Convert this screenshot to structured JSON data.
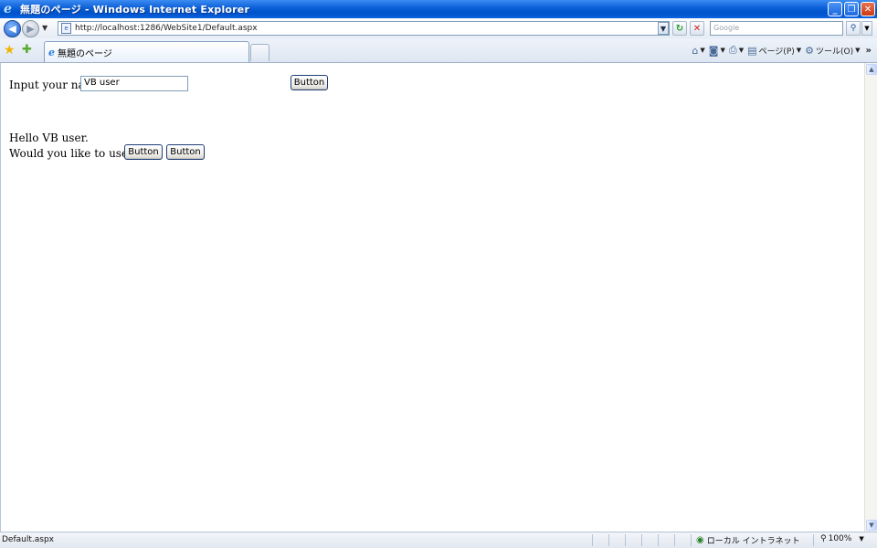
{
  "window": {
    "title": "無題のページ - Windows Internet Explorer",
    "minimize": "_",
    "maximize": "❐",
    "close": "✕"
  },
  "address_bar": {
    "url": "http://localhost:1286/WebSite1/Default.aspx",
    "search_placeholder": "Google"
  },
  "tabs": [
    {
      "label": "無題のページ"
    }
  ],
  "command_bar": {
    "page_label": "ページ(P)",
    "tools_label": "ツール(O)"
  },
  "page": {
    "name_label": "Input your name",
    "name_value": "VB user",
    "submit_button": "Button",
    "greeting": "Hello VB user.",
    "db_question": "Would you like to use DB?",
    "db_button_1": "Button",
    "db_button_2": "Button"
  },
  "status_bar": {
    "status_text": "Default.aspx",
    "zone": "ローカル イントラネット",
    "zoom": "100%"
  }
}
